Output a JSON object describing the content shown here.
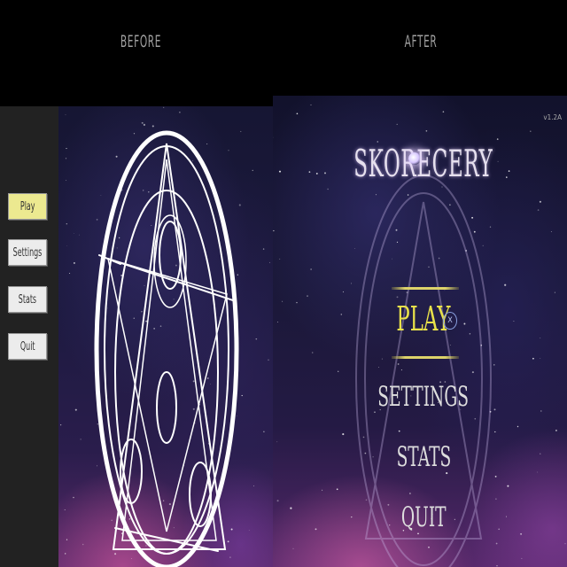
{
  "headings": {
    "before": "BEFORE",
    "after": "AFTER"
  },
  "before": {
    "menu": [
      {
        "label": "Play",
        "selected": true
      },
      {
        "label": "Settings",
        "selected": false
      },
      {
        "label": "Stats",
        "selected": false
      },
      {
        "label": "Quit",
        "selected": false
      }
    ]
  },
  "after": {
    "version": "v1.2A",
    "logo": "SKORECERY",
    "menu": [
      {
        "label": "PLAY",
        "selected": true
      },
      {
        "label": "SETTINGS",
        "selected": false
      },
      {
        "label": "STATS",
        "selected": false
      },
      {
        "label": "QUIT",
        "selected": false
      }
    ],
    "select_hint_icon": "controller-face-button-icon",
    "select_hint_glyph": "X"
  },
  "colors": {
    "highlight_gold": "#e8e04a",
    "old_selected_button": "#ece990",
    "old_button": "#ececec",
    "sidebar": "#222222"
  }
}
